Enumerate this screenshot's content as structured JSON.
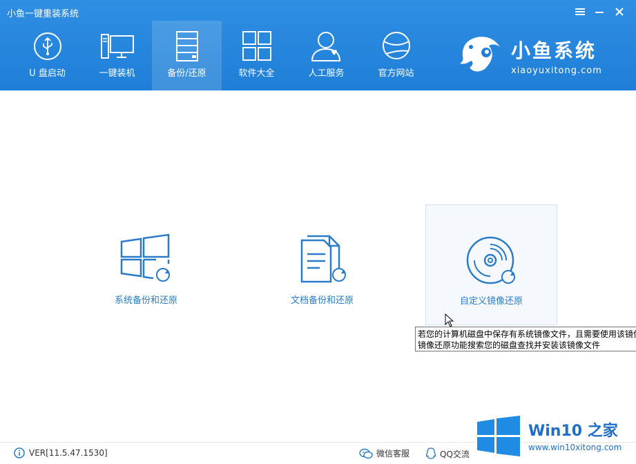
{
  "window": {
    "title": "小鱼一键重装系统"
  },
  "nav": {
    "items": [
      {
        "label": "U 盘启动"
      },
      {
        "label": "一键装机"
      },
      {
        "label": "备份/还原"
      },
      {
        "label": "软件大全"
      },
      {
        "label": "人工服务"
      },
      {
        "label": "官方网站"
      }
    ],
    "active_index": 2
  },
  "brand": {
    "name": "小鱼系统",
    "url": "xiaoyuxitong.com"
  },
  "cards": [
    {
      "label": "系统备份和还原",
      "icon": "windows-restore-icon"
    },
    {
      "label": "文档备份和还原",
      "icon": "document-restore-icon"
    },
    {
      "label": "自定义镜像还原",
      "icon": "disc-restore-icon"
    }
  ],
  "tooltip": {
    "line1": "若您的计算机磁盘中保存有系统镜像文件，且需要使用该镜像",
    "line2": "镜像还原功能搜索您的磁盘查找并安装该镜像文件"
  },
  "footer": {
    "version": "VER[11.5.47.1530]",
    "wechat": "微信客服",
    "qq": "QQ交流"
  },
  "watermark": {
    "title": "Win10 之家",
    "url": "www.win10xitong.com"
  },
  "colors": {
    "header": "#1f7ed7",
    "accent": "#2a7bc9"
  }
}
